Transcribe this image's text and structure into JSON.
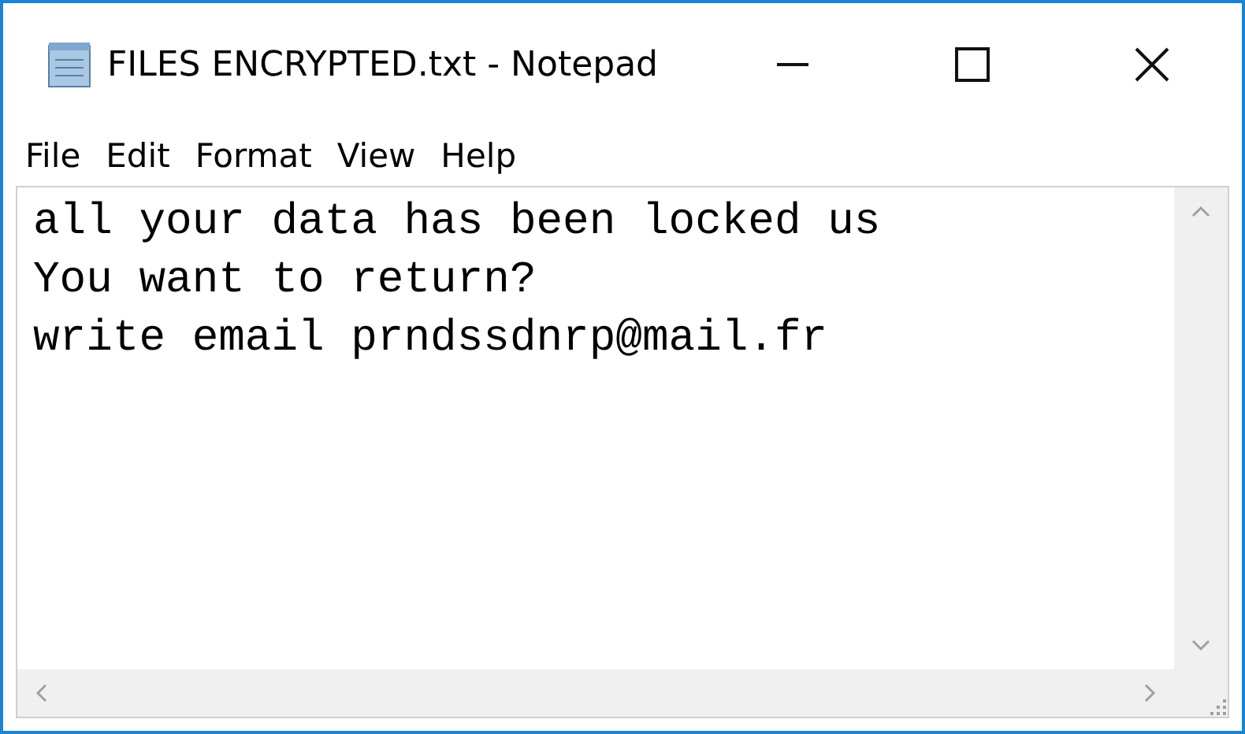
{
  "window": {
    "title": "FILES ENCRYPTED.txt - Notepad"
  },
  "menu": [
    {
      "label": "File"
    },
    {
      "label": "Edit"
    },
    {
      "label": "Format"
    },
    {
      "label": "View"
    },
    {
      "label": "Help"
    }
  ],
  "document": {
    "lines": [
      "all your data has been locked us",
      "You want to return?",
      "write email prndssdnrp@mail.fr"
    ]
  }
}
